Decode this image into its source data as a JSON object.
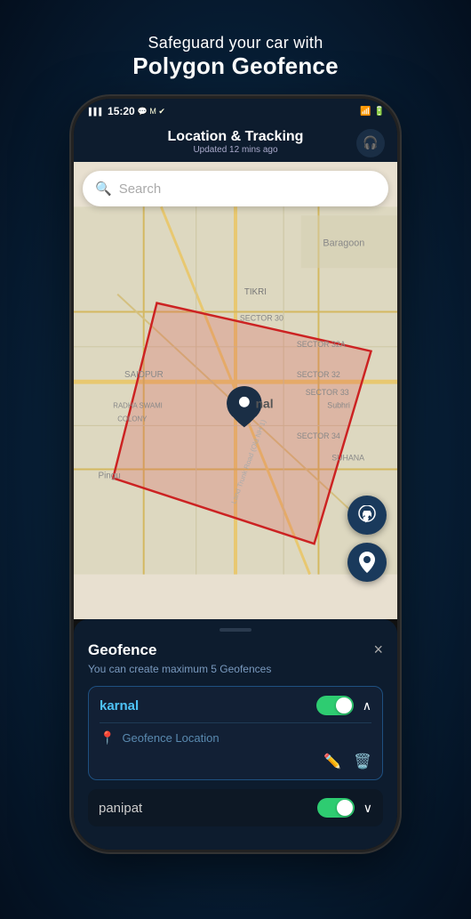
{
  "page": {
    "bg_top_text1": "Safeguard your car with",
    "bg_top_text2": "Polygon Geofence"
  },
  "status_bar": {
    "time": "15:20",
    "signal": "4G",
    "battery_icon": "🔋"
  },
  "app_header": {
    "title": "Location & Tracking",
    "subtitle": "Updated 12 mins ago",
    "headphone_icon": "🎧"
  },
  "search": {
    "placeholder": "Search",
    "icon": "search"
  },
  "map_fabs": {
    "car_icon": "🚗",
    "pin_icon": "📍"
  },
  "bottom_panel": {
    "title": "Geofence",
    "close_label": "×",
    "description": "You can create maximum 5 Geofences",
    "geofences": [
      {
        "name": "karnal",
        "enabled": true,
        "expanded": true,
        "location_label": "Geofence Location"
      },
      {
        "name": "panipat",
        "enabled": true,
        "expanded": false,
        "location_label": ""
      }
    ]
  }
}
